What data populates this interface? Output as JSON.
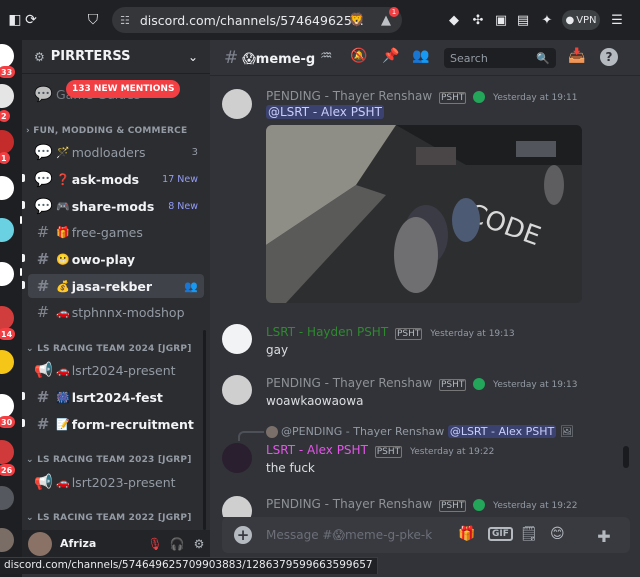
{
  "browser": {
    "url": "discord.com/channels/574649625...",
    "vpn_label": "VPN",
    "status_link": "discord.com/channels/574649625709903883/1286379599663599657",
    "brave_badge": "1"
  },
  "servers": {
    "badges": [
      "33",
      "2",
      "1",
      "14",
      "30",
      "26"
    ]
  },
  "guild": {
    "name": "PIRRTERSS",
    "mention_pill": "133 NEW MENTIONS",
    "hidden_channel": "Game Guides"
  },
  "categories": [
    "FUN, MODDING & COMMERCE",
    "LS RACING TEAM 2024 [JGRP]",
    "LS RACING TEAM 2023 [JGRP]",
    "LS RACING TEAM 2022 [JGRP]"
  ],
  "channels": [
    {
      "label": "modloaders",
      "icon": "🪄",
      "count": "3"
    },
    {
      "label": "ask-mods",
      "icon": "❓",
      "new": "17 New"
    },
    {
      "label": "share-mods",
      "icon": "🎮",
      "new": "8 New"
    },
    {
      "label": "free-games",
      "icon": "🎁"
    },
    {
      "label": "owo-play",
      "icon": "😬"
    },
    {
      "label": "jasa-rekber",
      "icon": "💰"
    },
    {
      "label": "stphnnx-modshop",
      "icon": "🚗"
    },
    {
      "label": "lsrt2024-present",
      "icon": "🚗"
    },
    {
      "label": "lsrt2024-fest",
      "icon": "🎆"
    },
    {
      "label": "form-recruitment",
      "icon": "📝"
    },
    {
      "label": "lsrt2023-present",
      "icon": "🚗"
    }
  ],
  "user": {
    "name": "Afriza"
  },
  "chat": {
    "channel_title": "😱meme-g",
    "search_placeholder": "Search",
    "composer_placeholder": "Message #😱meme-g-pke-k"
  },
  "messages": [
    {
      "author": "PENDING - Thayer Renshaw",
      "time": "Yesterday at 19:11",
      "text": "@LSRT - Alex PSHT"
    },
    {
      "author": "LSRT - Hayden PSHT",
      "time": "Yesterday at 19:13",
      "text": "gay"
    },
    {
      "author": "PENDING - Thayer Renshaw",
      "time": "Yesterday at 19:13",
      "text": "woawkaowaowa"
    },
    {
      "author": "LSRT - Alex PSHT",
      "time": "Yesterday at 19:22",
      "text": "the fuck",
      "reply_author": "@PENDING - Thayer Renshaw",
      "reply_mention": "@LSRT - Alex PSHT"
    },
    {
      "author": "PENDING - Thayer Renshaw",
      "time": "Yesterday at 19:22",
      "text": ""
    }
  ],
  "colors": {
    "pending_name": "#8e9297",
    "lsrt_green": "#2f8a2f",
    "lsrt_pink": "#e356e8",
    "mention_bg": "#3c4270",
    "accent_red": "#f23f43"
  }
}
